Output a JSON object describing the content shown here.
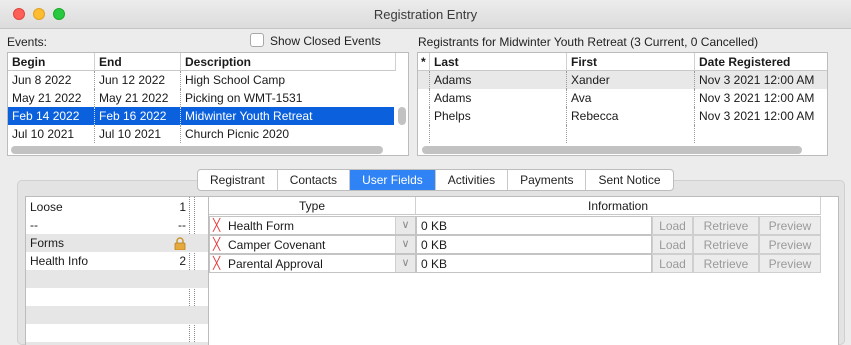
{
  "window": {
    "title": "Registration Entry"
  },
  "events": {
    "label": "Events:",
    "show_closed_label": "Show Closed Events",
    "columns": [
      "Begin",
      "End",
      "Description"
    ],
    "rows": [
      {
        "begin": "Jun 8 2022",
        "end": "Jun 12 2022",
        "description": "High School Camp",
        "selected": false
      },
      {
        "begin": "May 21 2022",
        "end": "May 21 2022",
        "description": "Picking on WMT-1531",
        "selected": false
      },
      {
        "begin": "Feb 14 2022",
        "end": "Feb 16 2022",
        "description": "Midwinter Youth Retreat",
        "selected": true
      },
      {
        "begin": "Jul 10 2021",
        "end": "Jul 10 2021",
        "description": "Church Picnic 2020",
        "selected": false
      }
    ]
  },
  "registrants": {
    "label": "Registrants for Midwinter Youth Retreat (3 Current, 0 Cancelled)",
    "columns": [
      "*",
      "Last",
      "First",
      "Date Registered"
    ],
    "rows": [
      {
        "last": "Adams",
        "first": "Xander",
        "date": "Nov 3 2021 12:00 AM"
      },
      {
        "last": "Adams",
        "first": "Ava",
        "date": "Nov 3 2021 12:00 AM"
      },
      {
        "last": "Phelps",
        "first": "Rebecca",
        "date": "Nov 3 2021 12:00 AM"
      }
    ]
  },
  "tabs": [
    {
      "label": "Registrant",
      "active": false
    },
    {
      "label": "Contacts",
      "active": false
    },
    {
      "label": "User Fields",
      "active": true
    },
    {
      "label": "Activities",
      "active": false
    },
    {
      "label": "Payments",
      "active": false
    },
    {
      "label": "Sent Notice",
      "active": false
    }
  ],
  "categories": [
    {
      "name": "Loose",
      "count": "1",
      "locked": false
    },
    {
      "name": "--",
      "count": "--",
      "locked": false
    },
    {
      "name": "Forms",
      "count": "",
      "locked": true
    },
    {
      "name": "Health Info",
      "count": "2",
      "locked": false
    }
  ],
  "user_fields": {
    "columns": [
      "Type",
      "Information"
    ],
    "buttons": [
      "Load",
      "Retrieve",
      "Preview"
    ],
    "rows": [
      {
        "type": "Health Form",
        "info": "0 KB"
      },
      {
        "type": "Camper Covenant",
        "info": "0 KB"
      },
      {
        "type": "Parental Approval",
        "info": "0 KB"
      }
    ]
  },
  "colors": {
    "selection": "#0b61dd",
    "active_tab": "#2f83f5",
    "missing_mark": "#e23c3c"
  }
}
